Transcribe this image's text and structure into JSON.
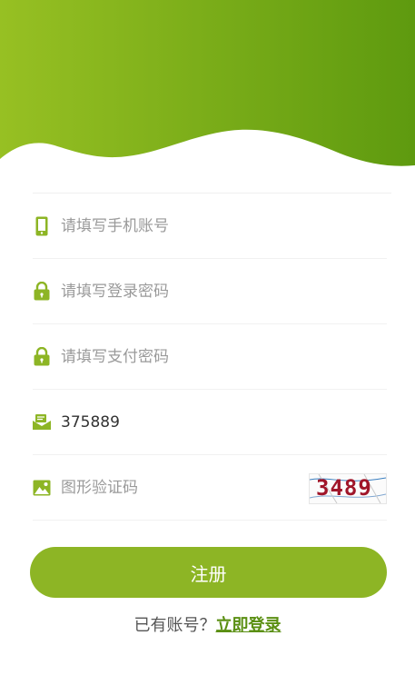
{
  "theme": {
    "accent": "#8db525",
    "accent_dark": "#5e9a0f",
    "link": "#5a8f12"
  },
  "fields": {
    "phone": {
      "icon": "phone-icon",
      "placeholder": "请填写手机账号",
      "value": ""
    },
    "login_password": {
      "icon": "lock-icon",
      "placeholder": "请填写登录密码",
      "value": ""
    },
    "pay_password": {
      "icon": "lock-icon",
      "placeholder": "请填写支付密码",
      "value": ""
    },
    "sms_code": {
      "icon": "mail-icon",
      "placeholder": "",
      "value": "375889"
    },
    "image_code": {
      "icon": "image-icon",
      "placeholder": "图形验证码",
      "value": "",
      "captcha_text": "3489"
    }
  },
  "submit_label": "注册",
  "login_prompt": {
    "text": "已有账号？",
    "link_label": "立即登录"
  }
}
